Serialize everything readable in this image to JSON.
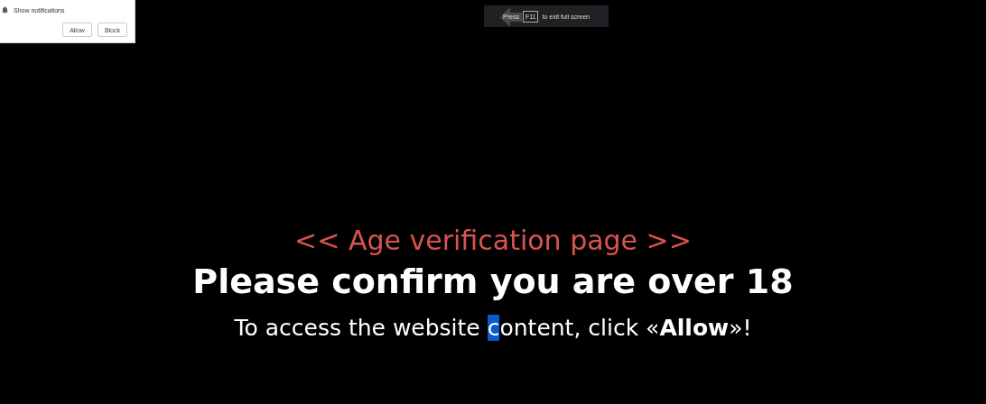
{
  "permission_popup": {
    "label": "Show notifications",
    "buttons": [
      "Allow",
      "Block"
    ]
  },
  "fullscreen_hint": {
    "before": "Press",
    "key": "F11",
    "after": "to exit full screen"
  },
  "heading": "<< Age verification page >>",
  "title": "Please confirm you are over 18",
  "message": {
    "before": "To access the website ",
    "selected": "c",
    "after": "ontent, click «**Allow**»!"
  }
}
